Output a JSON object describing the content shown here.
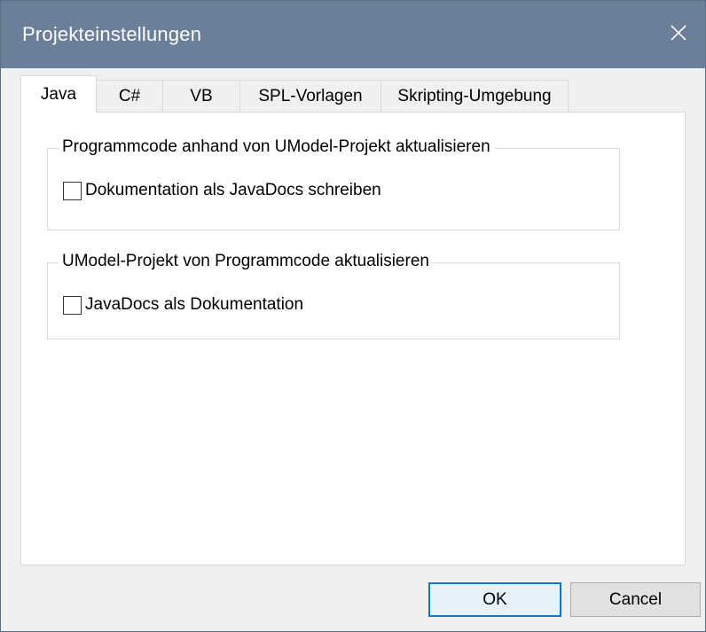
{
  "window": {
    "title": "Projekteinstellungen"
  },
  "tabs": [
    {
      "label": "Java",
      "active": true
    },
    {
      "label": "C#",
      "active": false
    },
    {
      "label": "VB",
      "active": false
    },
    {
      "label": "SPL-Vorlagen",
      "active": false
    },
    {
      "label": "Skripting-Umgebung",
      "active": false
    }
  ],
  "groups": {
    "code_update": {
      "legend": "Programmcode anhand von UModel-Projekt aktualisieren",
      "checkbox_label": "Dokumentation als JavaDocs schreiben",
      "checked": false
    },
    "model_update": {
      "legend": "UModel-Projekt von Programmcode aktualisieren",
      "checkbox_label": "JavaDocs als Dokumentation",
      "checked": false
    }
  },
  "buttons": {
    "ok": "OK",
    "cancel": "Cancel"
  },
  "icons": {
    "close": "close-icon"
  },
  "colors": {
    "titlebar": "#6b7f99",
    "default_button_border": "#0078d7"
  }
}
